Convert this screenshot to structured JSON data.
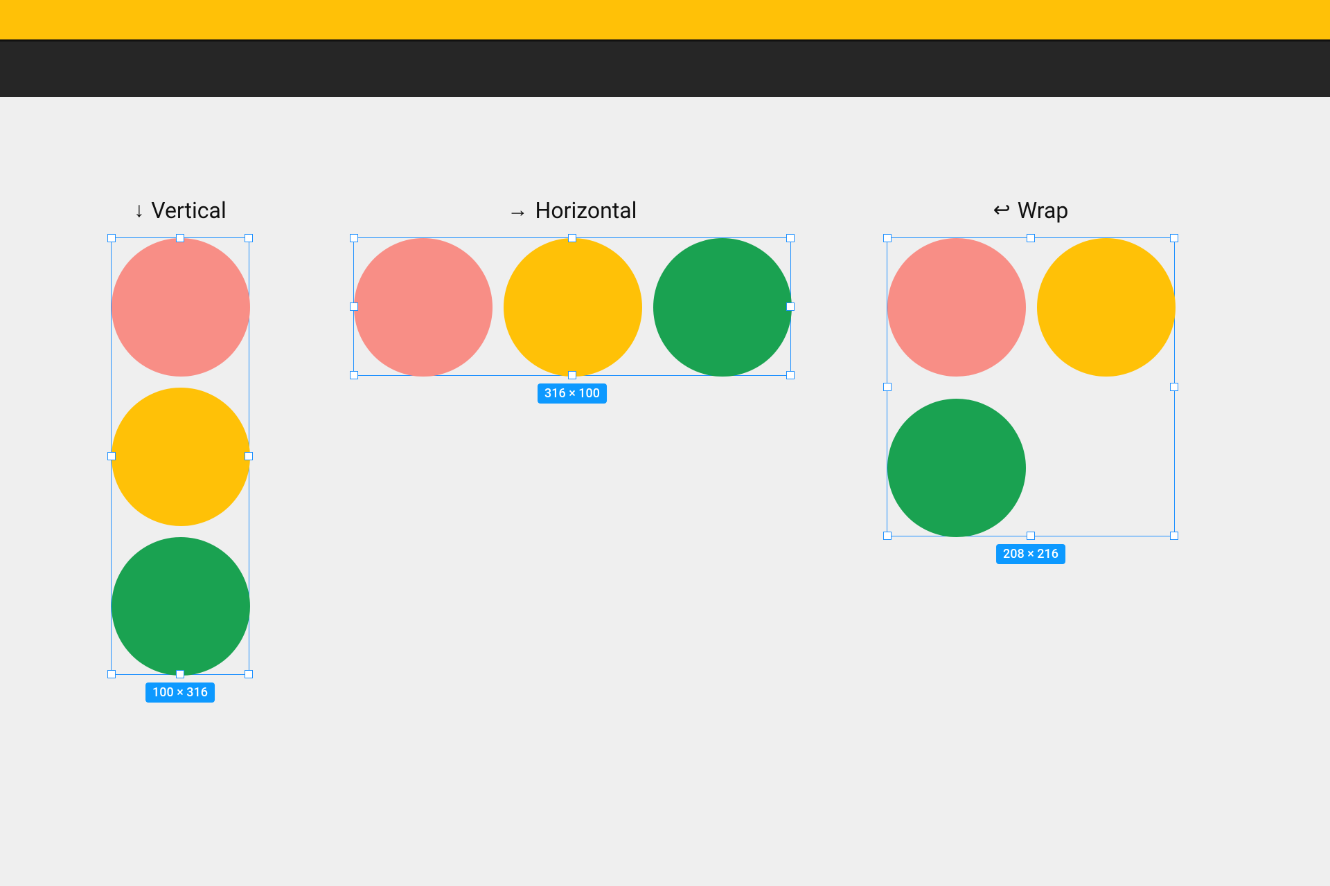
{
  "colors": {
    "yellow_bar": "#ffc107",
    "dark_bar": "#262626",
    "canvas_bg": "#efefef",
    "selection": "#1e90ff",
    "badge": "#0d99ff",
    "circle_pink": "#f88e86",
    "circle_yellow": "#ffc107",
    "circle_green": "#1aa251"
  },
  "examples": {
    "vertical": {
      "icon": "↓",
      "label": "Vertical",
      "dimensions": "100 × 316"
    },
    "horizontal": {
      "icon": "→",
      "label": "Horizontal",
      "dimensions": "316 × 100"
    },
    "wrap": {
      "icon": "↩",
      "label": "Wrap",
      "dimensions": "208 × 216"
    }
  }
}
